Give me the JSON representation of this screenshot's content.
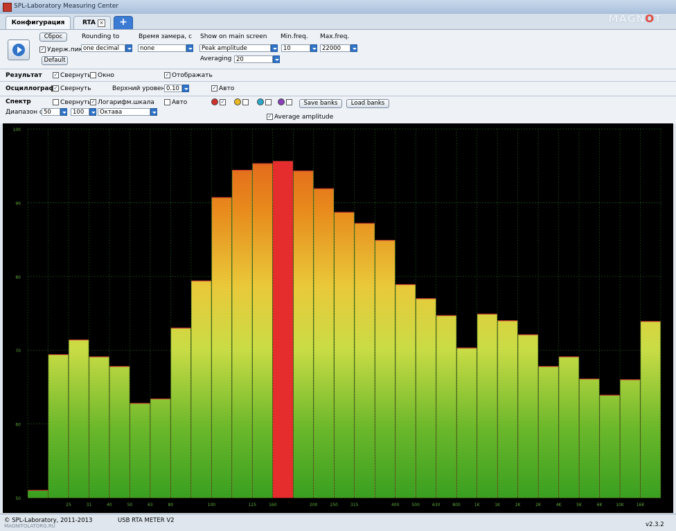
{
  "window": {
    "title": "SPL-Laboratory Measuring Center"
  },
  "logo": {
    "text_before": "MAGN",
    "text_o": "O",
    "text_after": "T"
  },
  "tabs": [
    {
      "label": "Конфигурация"
    },
    {
      "label": "RTA",
      "close": "×"
    },
    {
      "label": "+"
    }
  ],
  "controls": {
    "reset_label": "Сброс",
    "default_label": "Default",
    "hold_label": "Удерж.пик",
    "rounding_label": "Rounding to",
    "rounding_value": "one decimal",
    "time_label": "Время замера, с",
    "time_value": "none",
    "show_label": "Show on main screen",
    "show_value": "Peak amplitude",
    "averaging_label": "Averaging",
    "averaging_value": "20",
    "minfreq_label": "Min.freq.",
    "minfreq_value": "10",
    "maxfreq_label": "Max.freq.",
    "maxfreq_value": "22000"
  },
  "rows": {
    "result_label": "Результат",
    "result_collapse": "Свернуть",
    "result_window": "Окно",
    "result_show": "Отображать",
    "osc_label": "Осциллограф",
    "osc_collapse": "Свернуть",
    "osc_top_level_label": "Верхний уровень",
    "osc_top_level_value": "0.10",
    "osc_auto": "Авто",
    "spec_label": "Спектр",
    "spec_collapse": "Свернуть",
    "spec_log": "Логарифм.шкала",
    "spec_auto": "Авто",
    "save_banks": "Save banks",
    "load_banks": "Load banks",
    "range_label": "Диапазон dB",
    "range_min": "50",
    "range_max": "100",
    "octave_value": "Октава",
    "avg_amplitude": "Average amplitude"
  },
  "bank_colors": [
    "#d0312d",
    "#e8b923",
    "#2aa8c9",
    "#8a3fb8"
  ],
  "chart_data": {
    "type": "bar",
    "ylim": [
      50,
      100
    ],
    "yticks": [
      "100",
      "90",
      "80",
      "70",
      "60",
      "50"
    ],
    "categories": [
      "20",
      "25",
      "31",
      "40",
      "50",
      "63",
      "80",
      "100",
      "125",
      "160",
      "200",
      "250",
      "315",
      "400",
      "500",
      "630",
      "800",
      "1K",
      "1.2K",
      "1.6K",
      "2K",
      "2.5K",
      "3.2K",
      "4K",
      "5K",
      "6.3K",
      "8K",
      "10K",
      "12K",
      "16K"
    ],
    "xtick_labels": [
      "25",
      "31",
      "40",
      "50",
      "63",
      "80",
      "100",
      "125",
      "160",
      "200",
      "250",
      "315",
      "400",
      "500",
      "630",
      "800",
      "1K",
      "1K",
      "2K",
      "2K",
      "4K",
      "5K",
      "6K",
      "10K",
      "16K"
    ],
    "values": [
      51,
      69.4,
      71.4,
      69.1,
      67.8,
      62.8,
      63.4,
      73,
      79.4,
      90.7,
      94.4,
      95.3,
      95.6,
      94.3,
      91.9,
      88.7,
      87.2,
      84.9,
      78.9,
      77,
      74.7,
      70.3,
      74.9,
      74,
      72.1,
      67.8,
      69.1,
      66.1,
      63.9,
      66,
      73.9
    ],
    "highlight_index": 12
  },
  "status": {
    "copyright": "© SPL-Laboratory, 2011-2013",
    "device": "USB RTA METER V2",
    "version": "v2.3.2"
  },
  "watermark": {
    "text": "MAGNITOLATORG.RU"
  }
}
